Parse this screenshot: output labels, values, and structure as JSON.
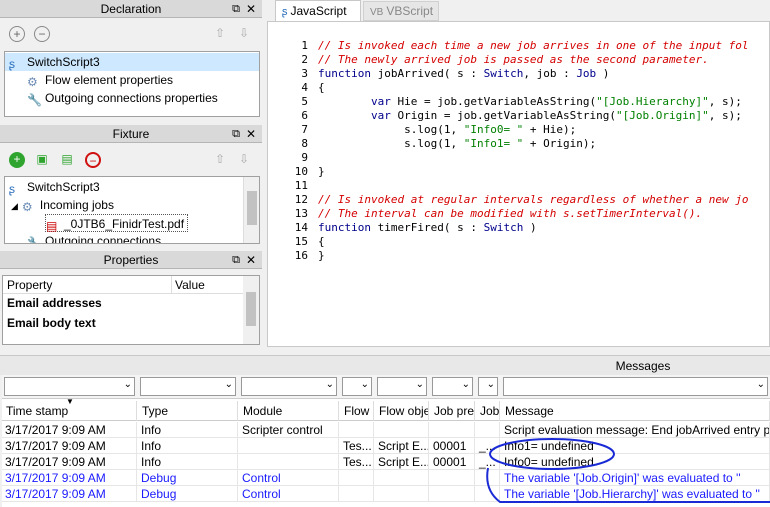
{
  "declaration": {
    "title": "Declaration",
    "items": [
      {
        "label": "SwitchScript3"
      },
      {
        "label": "Flow element properties"
      },
      {
        "label": "Outgoing connections properties"
      }
    ]
  },
  "fixture": {
    "title": "Fixture",
    "items": [
      {
        "label": "SwitchScript3"
      },
      {
        "label": "Incoming jobs"
      },
      {
        "label": "_0JTB6_FinidrTest.pdf"
      },
      {
        "label": "Outgoing connections"
      }
    ]
  },
  "properties": {
    "title": "Properties",
    "col_property": "Property",
    "col_value": "Value",
    "rows": [
      {
        "label": "Email addresses"
      },
      {
        "label": "Email body text"
      }
    ]
  },
  "editor": {
    "tabs": [
      {
        "label": "JavaScript",
        "active": true
      },
      {
        "label": "VBScript",
        "active": false
      }
    ],
    "lines": [
      {
        "n": "1",
        "t": "// Is invoked each time a new job arrives in one of the input fol"
      },
      {
        "n": "2",
        "t": "// The newly arrived job is passed as the second parameter."
      },
      {
        "n": "3",
        "t": "function jobArrived( s : Switch, job : Job )"
      },
      {
        "n": "4",
        "t": "{"
      },
      {
        "n": "5",
        "t": "        var Hie = job.getVariableAsString(\"[Job.Hierarchy]\", s);"
      },
      {
        "n": "6",
        "t": "        var Origin = job.getVariableAsString(\"[Job.Origin]\", s);"
      },
      {
        "n": "7",
        "t": "             s.log(1, \"Info0= \" + Hie);"
      },
      {
        "n": "8",
        "t": "             s.log(1, \"Info1= \" + Origin);"
      },
      {
        "n": "9",
        "t": ""
      },
      {
        "n": "10",
        "t": "}"
      },
      {
        "n": "11",
        "t": ""
      },
      {
        "n": "12",
        "t": "// Is invoked at regular intervals regardless of whether a new jo"
      },
      {
        "n": "13",
        "t": "// The interval can be modified with s.setTimerInterval()."
      },
      {
        "n": "14",
        "t": "function timerFired( s : Switch )"
      },
      {
        "n": "15",
        "t": "{"
      },
      {
        "n": "16",
        "t": "}"
      }
    ]
  },
  "messages": {
    "title": "Messages",
    "columns": [
      "Time stamp",
      "Type",
      "Module",
      "Flow",
      "Flow obje",
      "Job pre",
      "Job",
      "Message"
    ],
    "rows": [
      {
        "time": "3/17/2017 9:09 AM",
        "type": "Info",
        "module": "Scripter control",
        "flow": "",
        "flowobj": "",
        "jobpre": "",
        "job": "",
        "msg": "Script evaluation message: End jobArrived entry po",
        "blue": false
      },
      {
        "time": "3/17/2017 9:09 AM",
        "type": "Info",
        "module": "",
        "flow": "Tes...",
        "flowobj": "Script E...",
        "jobpre": "00001",
        "job": "_...",
        "msg": "Info1= undefined",
        "blue": false
      },
      {
        "time": "3/17/2017 9:09 AM",
        "type": "Info",
        "module": "",
        "flow": "Tes...",
        "flowobj": "Script E...",
        "jobpre": "00001",
        "job": "_...",
        "msg": "Info0= undefined",
        "blue": false
      },
      {
        "time": "3/17/2017 9:09 AM",
        "type": "Debug",
        "module": "Control",
        "flow": "",
        "flowobj": "",
        "jobpre": "",
        "job": "",
        "msg": "The variable '[Job.Origin]' was evaluated to ''",
        "blue": true
      },
      {
        "time": "3/17/2017 9:09 AM",
        "type": "Debug",
        "module": "Control",
        "flow": "",
        "flowobj": "",
        "jobpre": "",
        "job": "",
        "msg": "The variable '[Job.Hierarchy]' was evaluated to ''",
        "blue": true
      }
    ]
  }
}
